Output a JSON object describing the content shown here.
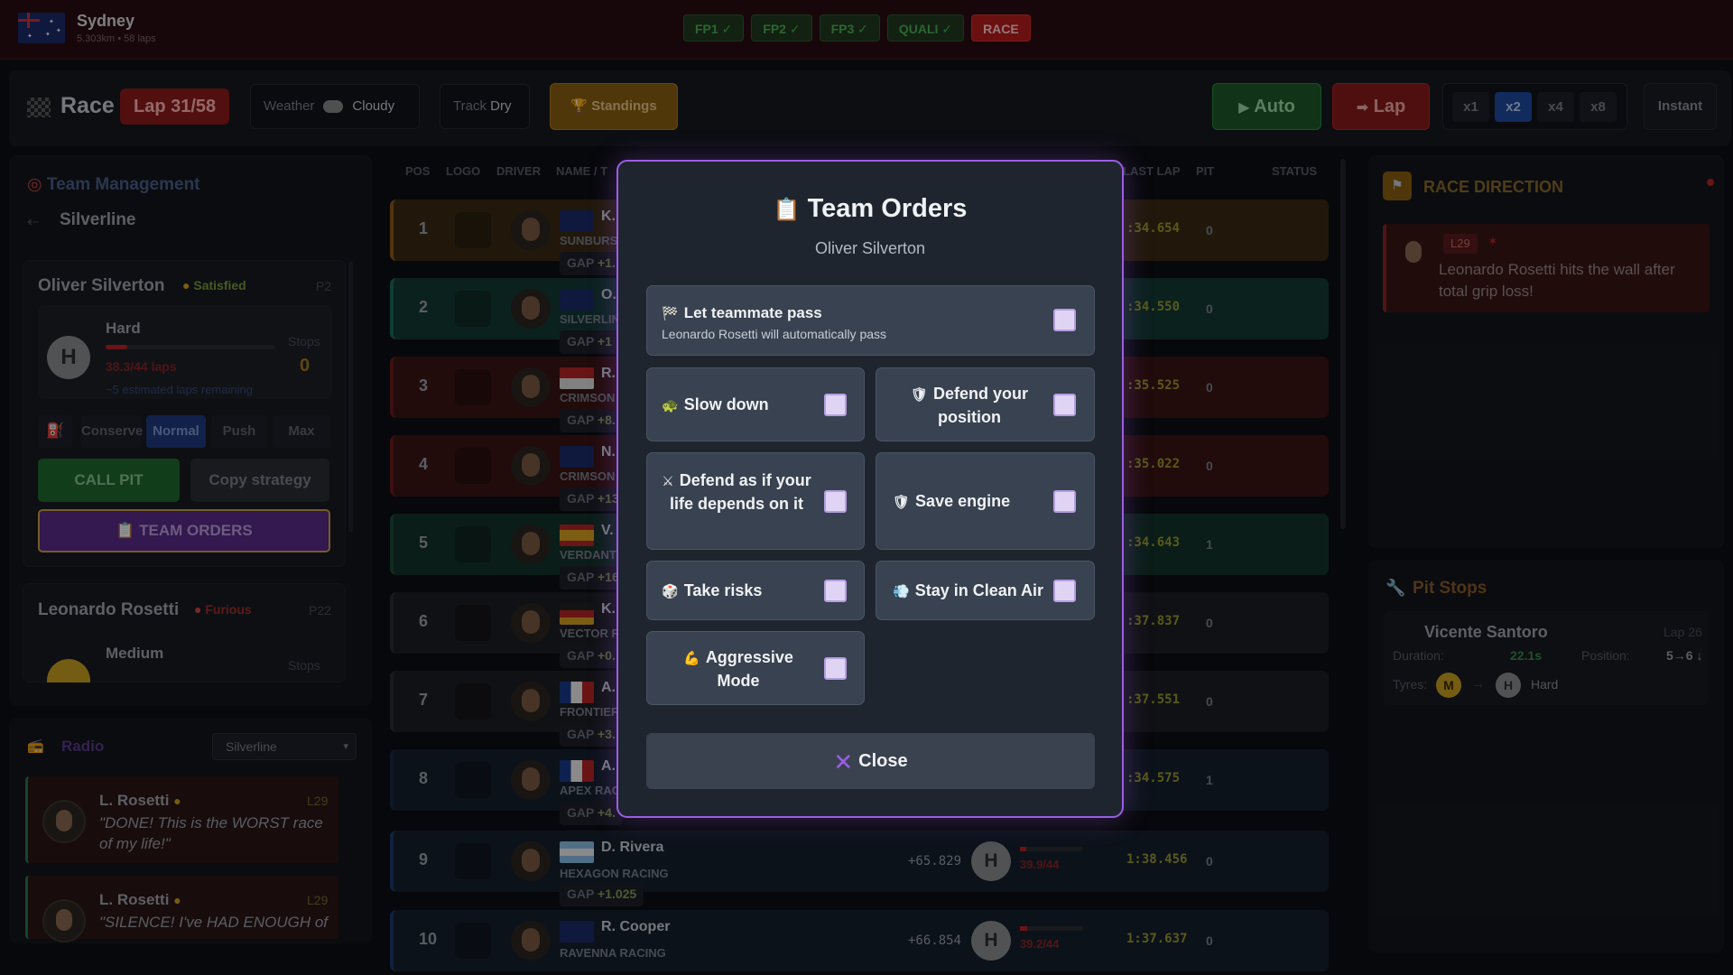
{
  "top": {
    "city": "Sydney",
    "city_sub": "5.303km • 58 laps",
    "sessions": [
      "FP1 ✓",
      "FP2 ✓",
      "FP3 ✓",
      "QUALI ✓",
      "RACE"
    ]
  },
  "toolbar": {
    "race_label": "Race",
    "lap": "Lap 31/58",
    "weather_label": "Weather",
    "weather_value": "Cloudy",
    "track_label": "Track",
    "track_value": "Dry",
    "standings": "Standings",
    "auto": "Auto",
    "lap_btn": "Lap",
    "speeds": [
      "x1",
      "x2",
      "x4",
      "x8"
    ],
    "speed_selected": "x2",
    "instant": "Instant"
  },
  "team_mgmt": {
    "title": "Team Management",
    "team": "Silverline",
    "driver1": {
      "name": "Oliver Silverton",
      "mood": "Satisfied",
      "pos": "P2",
      "tyre_letter": "H",
      "tyre": "Hard",
      "laps": "38.3/44 laps",
      "stops_label": "Stops",
      "stops": "0",
      "estimate": "~5 estimated laps remaining"
    },
    "modes": [
      "Conserve",
      "Normal",
      "Push",
      "Max"
    ],
    "mode_selected": "Normal",
    "call_pit": "CALL PIT",
    "copy_strategy": "Copy strategy",
    "team_orders": "TEAM ORDERS",
    "driver2": {
      "name": "Leonardo Rosetti",
      "mood": "Furious",
      "pos": "P22",
      "tyre": "Medium",
      "stops_label": "Stops"
    }
  },
  "radio": {
    "title": "Radio",
    "filter": "Silverline",
    "messages": [
      {
        "from": "L. Rosetti",
        "lap": "L29",
        "text": "\"DONE! This is the WORST race of my life!\""
      },
      {
        "from": "L. Rosetti",
        "lap": "L29",
        "text": "\"SILENCE! I've HAD ENOUGH of"
      }
    ]
  },
  "table": {
    "headers": [
      "POS",
      "LOGO",
      "DRIVER",
      "NAME / T",
      "LAST LAP",
      "PIT",
      "STATUS"
    ],
    "rows": [
      {
        "pos": "1",
        "name": "K.",
        "team": "SUNBURS",
        "gap": "GAP",
        "gapv": "+1.",
        "lastlap": ":34.654",
        "pit": "0"
      },
      {
        "pos": "2",
        "name": "O.",
        "team": "SILVERLIN",
        "gap": "GAP",
        "gapv": "+1",
        "lastlap": ":34.550",
        "pit": "0"
      },
      {
        "pos": "3",
        "name": "R.",
        "team": "CRIMSON",
        "gap": "GAP",
        "gapv": "+8.",
        "lastlap": ":35.525",
        "pit": "0"
      },
      {
        "pos": "4",
        "name": "N.",
        "team": "CRIMSON",
        "gap": "GAP",
        "gapv": "+13",
        "lastlap": ":35.022",
        "pit": "0"
      },
      {
        "pos": "5",
        "name": "V.",
        "team": "VERDANT",
        "gap": "GAP",
        "gapv": "+16",
        "lastlap": ":34.643",
        "pit": "1"
      },
      {
        "pos": "6",
        "name": "K.",
        "team": "VECTOR R",
        "gap": "GAP",
        "gapv": "+0.",
        "lastlap": ":37.837",
        "pit": "0"
      },
      {
        "pos": "7",
        "name": "A.",
        "team": "FRONTIER",
        "gap": "GAP",
        "gapv": "+3.",
        "lastlap": ":37.551",
        "pit": "0"
      },
      {
        "pos": "8",
        "name": "A.",
        "team": "APEX RAC",
        "gap": "GAP",
        "gapv": "+4.",
        "lastlap": ":34.575",
        "pit": "1"
      },
      {
        "pos": "9",
        "name": "D. Rivera",
        "team": "HEXAGON RACING",
        "gap": "GAP",
        "gapv": "+1.025",
        "interval": "+65.829",
        "tyre": "H",
        "tyre_laps": "39.9/44",
        "lastlap": "1:38.456",
        "pit": "0"
      },
      {
        "pos": "10",
        "name": "R. Cooper",
        "team": "RAVENNA RACING",
        "gap": "",
        "gapv": "",
        "interval": "+66.854",
        "tyre": "H",
        "tyre_laps": "39.2/44",
        "lastlap": "1:37.637",
        "pit": "0"
      }
    ]
  },
  "race_direction": {
    "title": "RACE DIRECTION",
    "lap": "L29",
    "text": "Leonardo Rosetti hits the wall after total grip loss!"
  },
  "pit_stops": {
    "title": "Pit Stops",
    "driver": "Vicente Santoro",
    "lap": "Lap 26",
    "duration_label": "Duration:",
    "duration": "22.1s",
    "position_label": "Position:",
    "position": "5→6 ↓",
    "tyres_label": "Tyres:",
    "from_tyre": "M",
    "to_tyre": "H",
    "to_tyre_name": "Hard"
  },
  "modal": {
    "title": "Team Orders",
    "subtitle": "Oliver Silverton",
    "let_pass": "Let teammate pass",
    "let_pass_sub": "Leonardo Rosetti will automatically pass",
    "slow_down": "Slow down",
    "defend_pos": "Defend your position",
    "defend_life": "Defend as if your life depends on it",
    "save_engine": "Save engine",
    "take_risks": "Take risks",
    "clean_air": "Stay in Clean Air",
    "aggressive": "Aggressive Mode",
    "close": "Close"
  },
  "colors": {
    "modal_border": "#9b5de5",
    "race_red": "#b71c1c",
    "auto_green": "#1e5a2a"
  }
}
